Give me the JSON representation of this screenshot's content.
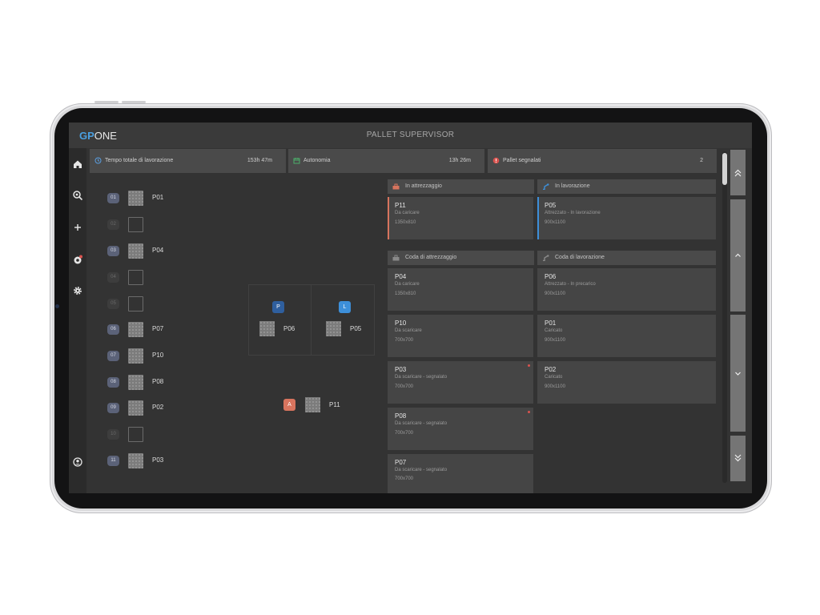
{
  "app": {
    "logo_gp": "GP",
    "logo_one": "ONE",
    "title": "PALLET SUPERVISOR"
  },
  "nav": {
    "items": [
      "home-icon",
      "search-settings-icon",
      "plus-icon",
      "alert-icon",
      "gear-icon"
    ],
    "bottom": "user-icon"
  },
  "stats": [
    {
      "label": "Tempo totale di lavorazione",
      "value": "153h 47m",
      "icon": "clock-icon"
    },
    {
      "label": "Autonomia",
      "value": "13h 26m",
      "icon": "calendar-icon"
    },
    {
      "label": "Pallet segnalati",
      "value": "2",
      "icon": "warning-icon"
    }
  ],
  "slots": [
    {
      "num": "01",
      "label": "P01",
      "filled": true
    },
    {
      "num": "02",
      "label": "",
      "filled": false
    },
    {
      "num": "03",
      "label": "P04",
      "filled": true
    },
    {
      "num": "04",
      "label": "",
      "filled": false
    },
    {
      "num": "05",
      "label": "",
      "filled": false
    },
    {
      "num": "06",
      "label": "P07",
      "filled": true
    },
    {
      "num": "07",
      "label": "P10",
      "filled": true
    },
    {
      "num": "08",
      "label": "P08",
      "filled": true
    },
    {
      "num": "09",
      "label": "P02",
      "filled": true
    },
    {
      "num": "10",
      "label": "",
      "filled": false
    },
    {
      "num": "11",
      "label": "P03",
      "filled": true
    }
  ],
  "stations": {
    "p": {
      "badge": "P",
      "pallet": "P06",
      "color": "#2f5f9e"
    },
    "l": {
      "badge": "L",
      "pallet": "P05",
      "color": "#3d8fd9"
    },
    "a": {
      "badge": "A",
      "pallet": "P11",
      "color": "#d8745e"
    }
  },
  "columns": {
    "attrezzaggio": {
      "title": "In attrezzaggio",
      "icon": "toolbox-icon"
    },
    "lavorazione": {
      "title": "In lavorazione",
      "icon": "robot-arm-icon"
    },
    "coda_attrezzaggio": {
      "title": "Coda di attrezzaggio",
      "icon": "toolbox-icon"
    },
    "coda_lavorazione": {
      "title": "Coda di lavorazione",
      "icon": "robot-arm-icon"
    }
  },
  "cards": {
    "attrezzaggio": [
      {
        "id": "P11",
        "status": "Da caricare",
        "dim": "1350x810",
        "edge": "#d8745e"
      }
    ],
    "lavorazione": [
      {
        "id": "P05",
        "status": "Attrezzato - In lavorazione",
        "dim": "900x1100",
        "edge": "#3d8fd9"
      }
    ],
    "coda_attrezzaggio": [
      {
        "id": "P04",
        "status": "Da caricare",
        "dim": "1350x810"
      },
      {
        "id": "P10",
        "status": "Da scaricare",
        "dim": "700x700"
      },
      {
        "id": "P03",
        "status": "Da scaricare - segnalato",
        "dim": "700x700",
        "flag": true
      },
      {
        "id": "P08",
        "status": "Da scaricare - segnalato",
        "dim": "700x700",
        "flag": true
      },
      {
        "id": "P07",
        "status": "Da scaricare - segnalato",
        "dim": "700x700"
      }
    ],
    "coda_lavorazione": [
      {
        "id": "P06",
        "status": "Attrezzato - In precarico",
        "dim": "900x1100"
      },
      {
        "id": "P01",
        "status": "Caricato",
        "dim": "900x1100"
      },
      {
        "id": "P02",
        "status": "Caricato",
        "dim": "900x1100"
      }
    ]
  },
  "scroll": {
    "buttons": [
      "double-chevron-up-icon",
      "chevron-up-icon",
      "chevron-down-icon",
      "double-chevron-down-icon"
    ]
  }
}
